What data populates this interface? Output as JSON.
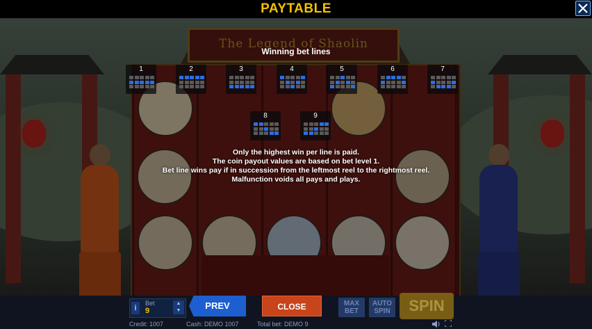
{
  "header": {
    "title": "PAYTABLE",
    "close_icon": "close-x-icon",
    "accent": "#f2c200"
  },
  "game": {
    "logo_text": "The Legend of Shaolin"
  },
  "paytable": {
    "section_title": "Winning bet lines",
    "lines": [
      {
        "label": "1",
        "rows": [
          1,
          1,
          1,
          1,
          1
        ]
      },
      {
        "label": "2",
        "rows": [
          0,
          0,
          0,
          0,
          0
        ]
      },
      {
        "label": "3",
        "rows": [
          2,
          2,
          2,
          2,
          2
        ]
      },
      {
        "label": "4",
        "rows": [
          0,
          1,
          2,
          1,
          0
        ]
      },
      {
        "label": "5",
        "rows": [
          2,
          1,
          0,
          1,
          2
        ]
      },
      {
        "label": "6",
        "rows": [
          1,
          0,
          0,
          0,
          1
        ]
      },
      {
        "label": "7",
        "rows": [
          1,
          2,
          2,
          2,
          1
        ]
      },
      {
        "label": "8",
        "rows": [
          0,
          0,
          1,
          2,
          2
        ]
      },
      {
        "label": "9",
        "rows": [
          2,
          2,
          1,
          0,
          0
        ]
      }
    ],
    "rules": [
      "Only the highest win per line is paid.",
      "The coin payout values are based on bet level 1.",
      "Bet line wins pay if in succession from the leftmost reel to the rightmost reel.",
      "Malfunction voids all pays and plays."
    ],
    "line_color": "#2d6ee0"
  },
  "controls": {
    "info_label": "i",
    "bet_label": "Bet",
    "bet_value": "9",
    "prev_label": "PREV",
    "close_label": "CLOSE",
    "max_bet_label": "MAX BET",
    "auto_spin_label": "AUTO SPIN",
    "spin_label": "SPIN"
  },
  "status_bar": {
    "credit": "Credit: 1007",
    "cash": "Cash: DEMO 1007",
    "total_bet": "Total bet: DEMO 9",
    "sound_icon": "speaker-icon",
    "fullscreen_icon": "fullscreen-icon"
  }
}
